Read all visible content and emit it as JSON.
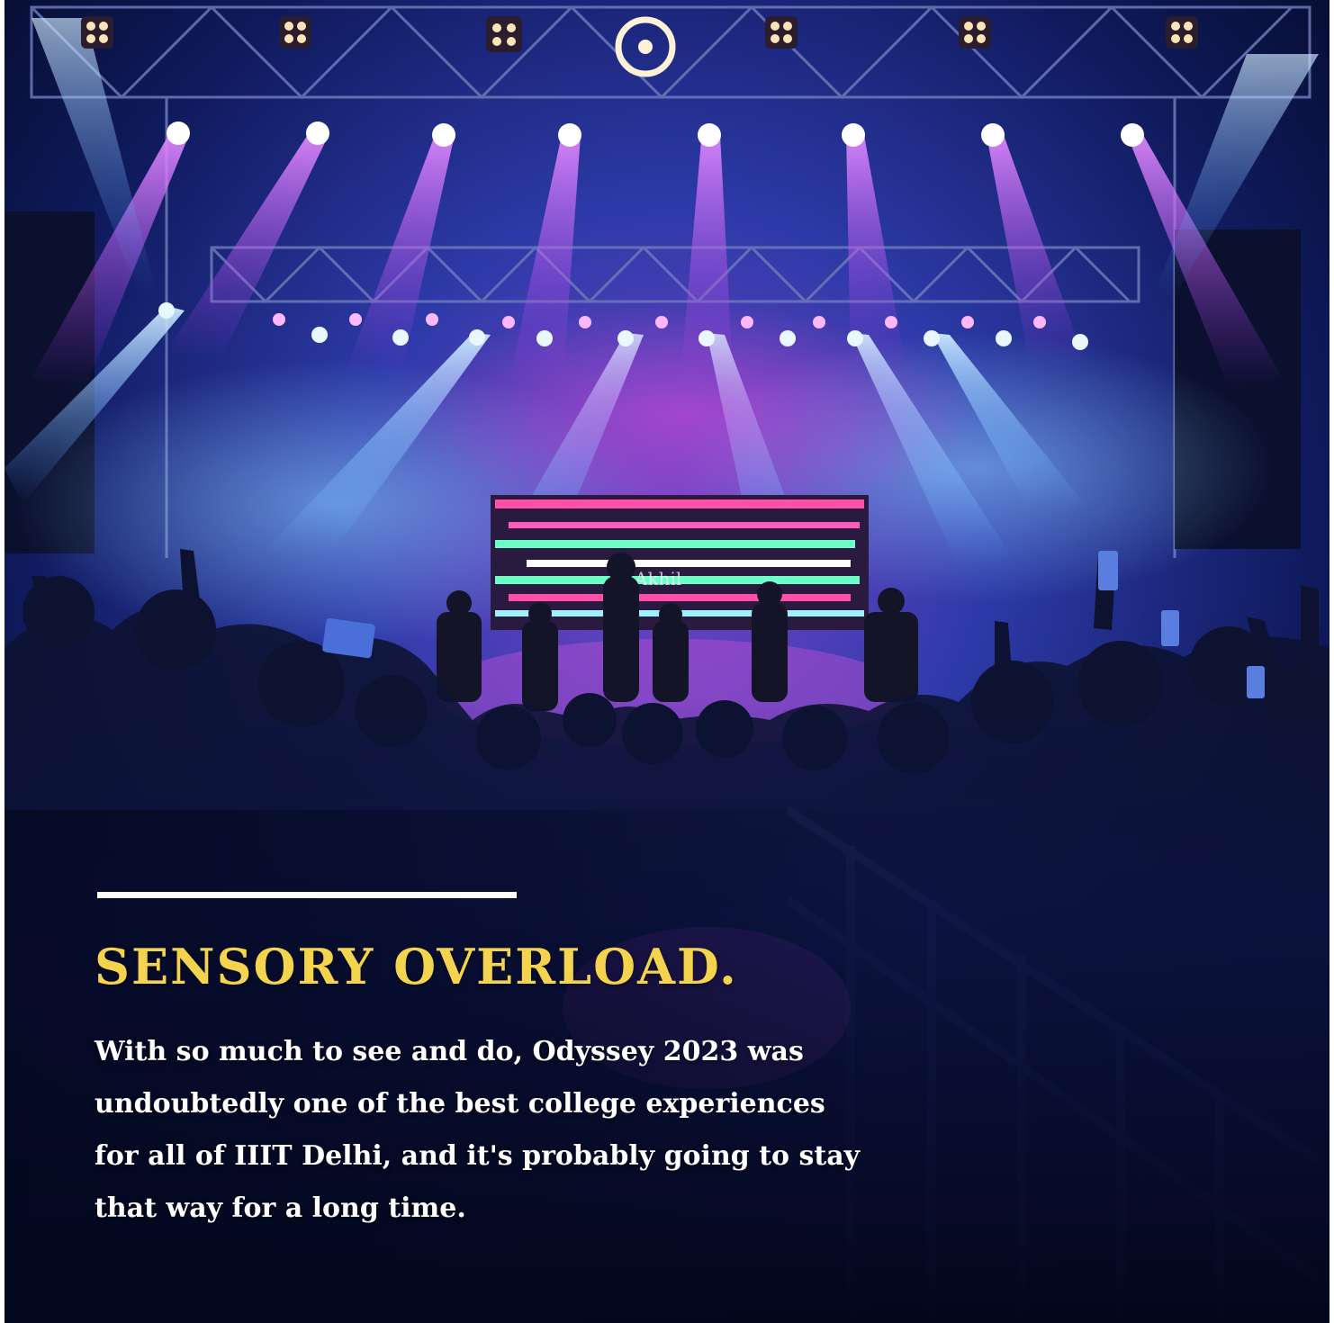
{
  "photo": {
    "description_icon": "concert-stage-photo",
    "screen_text": "Akhil"
  },
  "colors": {
    "headline": "#f4d34e",
    "body": "#ffffff",
    "rule": "#ffffff",
    "stage_purple": "#b23cf0",
    "stage_blue": "#2f8cff",
    "screen_pink": "#ff4fa8",
    "screen_green": "#6effc8"
  },
  "headline": "SENSORY OVERLOAD.",
  "body": "With so much to see and do, Odyssey 2023 was undoubtedly one of the best college experiences for all of IIIT Delhi, and it's probably going to stay that way for a long time."
}
